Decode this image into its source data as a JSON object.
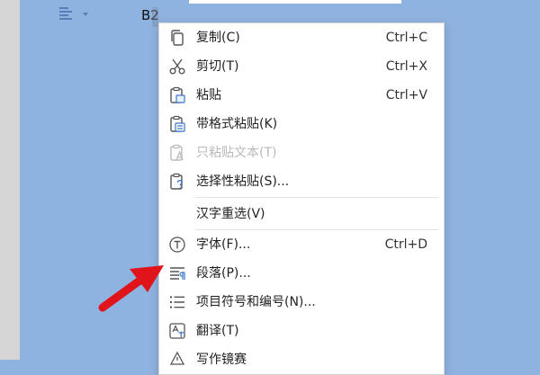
{
  "cell_ref": "B2",
  "context_menu": {
    "items": [
      {
        "label": "复制(C)",
        "shortcut": "Ctrl+C",
        "icon": "copy-icon"
      },
      {
        "label": "剪切(T)",
        "shortcut": "Ctrl+X",
        "icon": "scissors-icon"
      },
      {
        "label": "粘贴",
        "shortcut": "Ctrl+V",
        "icon": "paste-icon"
      },
      {
        "label": "带格式粘贴(K)",
        "shortcut": "",
        "icon": "paste-formatted-icon"
      },
      {
        "label": "只粘贴文本(T)",
        "shortcut": "",
        "icon": "paste-text-only-icon",
        "disabled": true
      },
      {
        "label": "选择性粘贴(S)...",
        "shortcut": "",
        "icon": "paste-special-icon"
      },
      {
        "label": "汉字重选(V)",
        "shortcut": "",
        "icon": ""
      },
      {
        "label": "字体(F)...",
        "shortcut": "Ctrl+D",
        "icon": "font-icon"
      },
      {
        "label": "段落(P)...",
        "shortcut": "",
        "icon": "paragraph-icon"
      },
      {
        "label": "项目符号和编号(N)...",
        "shortcut": "",
        "icon": "bullet-list-icon"
      },
      {
        "label": "翻译(T)",
        "shortcut": "",
        "icon": "translate-icon"
      },
      {
        "label": "写作镜赛",
        "shortcut": "",
        "icon": "writing-icon"
      }
    ]
  },
  "colors": {
    "background": "#8fb3e0",
    "arrow": "#e0141b",
    "icon": "#555555"
  }
}
